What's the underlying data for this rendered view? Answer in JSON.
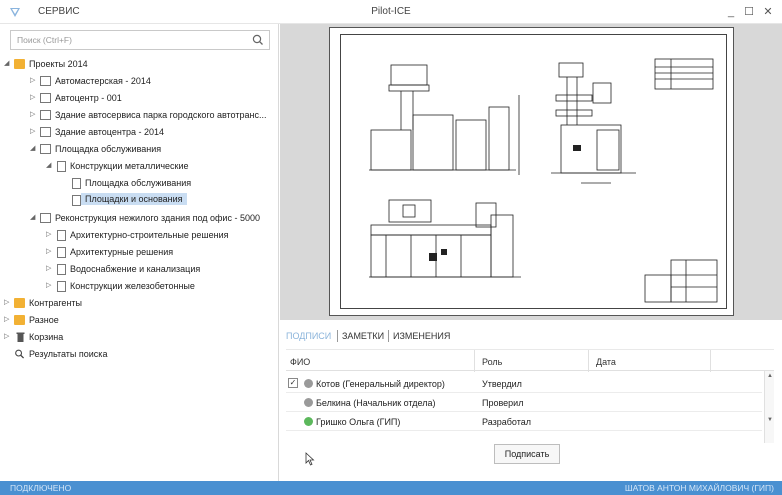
{
  "app": {
    "menu_label": "СЕРВИС",
    "window_title": "Pilot-ICE",
    "controls": {
      "minimize": "_",
      "maximize": "☐",
      "close": "✕"
    }
  },
  "search": {
    "placeholder": "Поиск (Ctrl+F)"
  },
  "tree": [
    {
      "label": "Проекты 2014",
      "icon": "folder-icon",
      "arrow": "◢"
    },
    {
      "label": "Автомастерская - 2014",
      "icon": "project-icon",
      "arrow": "▷"
    },
    {
      "label": "Автоцентр - 001",
      "icon": "project-icon",
      "arrow": "▷"
    },
    {
      "label": "Здание автосервиса парка городского автотранс...",
      "icon": "project-icon",
      "arrow": "▷"
    },
    {
      "label": "Здание автоцентра - 2014",
      "icon": "project-icon",
      "arrow": "▷"
    },
    {
      "label": "Площадка обслуживания",
      "icon": "project-icon",
      "arrow": "◢"
    },
    {
      "label": "Конструкции металлические",
      "icon": "document-icon",
      "arrow": "◢"
    },
    {
      "label": "Площадка обслуживания",
      "icon": "document-icon",
      "arrow": ""
    },
    {
      "label": "Площадки и основания",
      "icon": "document-icon",
      "arrow": "",
      "selected": true
    },
    {
      "label": "Реконструкция нежилого здания под офис - 5000",
      "icon": "project-icon",
      "arrow": "◢"
    },
    {
      "label": "Архитектурно-строительные решения",
      "icon": "document-icon",
      "arrow": "▷"
    },
    {
      "label": "Архитектурные решения",
      "icon": "document-icon",
      "arrow": "▷"
    },
    {
      "label": "Водоснабжение и канализация",
      "icon": "document-icon",
      "arrow": "▷"
    },
    {
      "label": "Конструкции железобетонные",
      "icon": "document-icon",
      "arrow": "▷"
    },
    {
      "label": "Контрагенты",
      "icon": "folder-icon",
      "arrow": "▷"
    },
    {
      "label": "Разное",
      "icon": "folder-icon",
      "arrow": "▷"
    },
    {
      "label": "Корзина",
      "icon": "trash-icon",
      "arrow": "▷"
    },
    {
      "label": "Результаты поиска",
      "icon": "search-results-icon",
      "arrow": ""
    }
  ],
  "tabs": [
    "ПОДПИСИ",
    "ЗАМЕТКИ",
    "ИЗМЕНЕНИЯ"
  ],
  "grid": {
    "headers": [
      "ФИО",
      "Роль",
      "Дата"
    ],
    "rows": [
      {
        "checked": true,
        "check_mark": "✓",
        "name": "Котов (Генеральный директор)",
        "role": "Утвердил",
        "date": "",
        "status_color": "#9a9a9a"
      },
      {
        "checked": false,
        "check_mark": "",
        "name": "Белкина (Начальник отдела)",
        "role": "Проверил",
        "date": "",
        "status_color": "#9a9a9a"
      },
      {
        "checked": false,
        "check_mark": "",
        "name": "Гришко Ольга (ГИП)",
        "role": "Разработал",
        "date": "",
        "status_color": "#5cb85c"
      }
    ]
  },
  "sign_button": "Подписать",
  "status": {
    "left": "ПОДКЛЮЧЕНО",
    "right": "ШАТОВ АНТОН МИХАЙЛОВИЧ (ГИП)"
  },
  "colors": {
    "accent": "#4a90d1",
    "selection": "#c9ddf2",
    "folder": "#f2b134"
  }
}
